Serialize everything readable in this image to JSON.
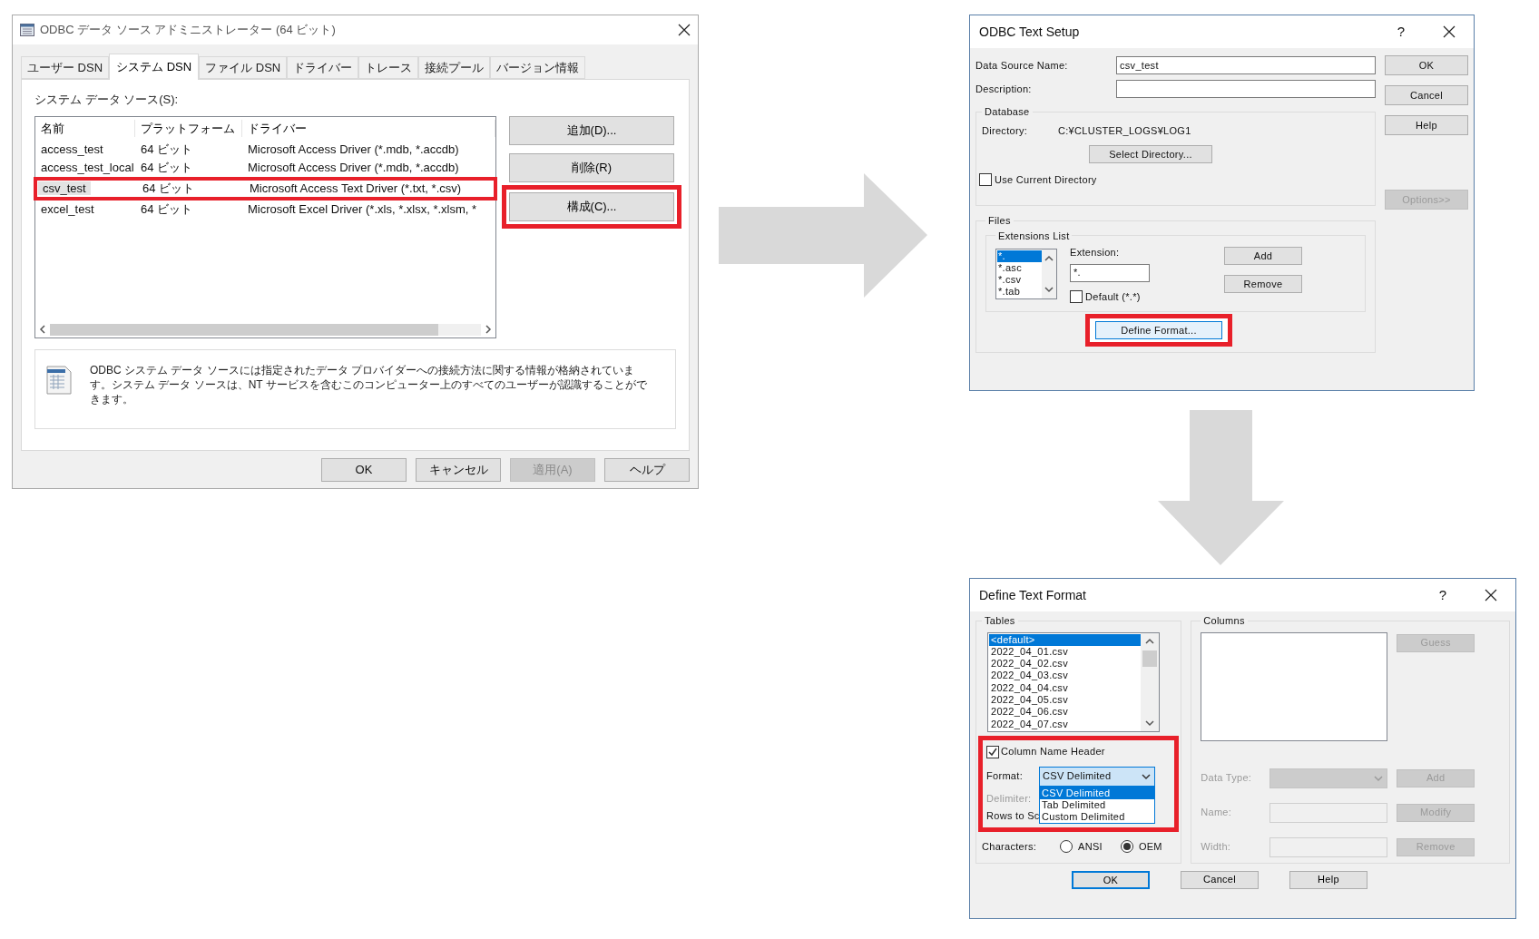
{
  "admin_window": {
    "title": "ODBC データ ソース アドミニストレーター (64 ビット)",
    "tabs": [
      {
        "label": "ユーザー DSN",
        "selected": false
      },
      {
        "label": "システム DSN",
        "selected": true
      },
      {
        "label": "ファイル DSN",
        "selected": false
      },
      {
        "label": "ドライバー",
        "selected": false
      },
      {
        "label": "トレース",
        "selected": false
      },
      {
        "label": "接続プール",
        "selected": false
      },
      {
        "label": "バージョン情報",
        "selected": false
      }
    ],
    "list_label": "システム データ ソース(S):",
    "columns": [
      "名前",
      "プラットフォーム",
      "ドライバー"
    ],
    "rows": [
      {
        "name": "access_test",
        "platform": "64 ビット",
        "driver": "Microsoft Access Driver (*.mdb, *.accdb)",
        "selected": false,
        "highlighted": false
      },
      {
        "name": "access_test_local",
        "platform": "64 ビット",
        "driver": "Microsoft Access Driver (*.mdb, *.accdb)",
        "selected": false,
        "highlighted": false
      },
      {
        "name": "csv_test",
        "platform": "64 ビット",
        "driver": "Microsoft Access Text Driver (*.txt, *.csv)",
        "selected": true,
        "highlighted": true
      },
      {
        "name": "excel_test",
        "platform": "64 ビット",
        "driver": "Microsoft Excel Driver (*.xls, *.xlsx, *.xlsm, *",
        "selected": false,
        "highlighted": false
      }
    ],
    "side_buttons": [
      {
        "label": "追加(D)...",
        "highlighted": false
      },
      {
        "label": "削除(R)",
        "highlighted": false
      },
      {
        "label": "構成(C)...",
        "highlighted": true
      }
    ],
    "info_text": "ODBC システム データ ソースには指定されたデータ プロバイダーへの接続方法に関する情報が格納されています。システム データ ソースは、NT サービスを含むこのコンピューター上のすべてのユーザーが認識することができます。",
    "footer_buttons": [
      {
        "label": "OK",
        "disabled": false
      },
      {
        "label": "キャンセル",
        "disabled": false
      },
      {
        "label": "適用(A)",
        "disabled": true
      },
      {
        "label": "ヘルプ",
        "disabled": false
      }
    ]
  },
  "text_setup": {
    "title": "ODBC Text Setup",
    "help_mark": "?",
    "fields": [
      {
        "label": "Data Source Name:",
        "value": "csv_test"
      },
      {
        "label": "Description:"
      }
    ],
    "database": {
      "legend": "Database",
      "directory_label": "Directory:",
      "directory": "C:¥CLUSTER_LOGS¥LOG1",
      "select_button": "Select Directory...",
      "use_current": {
        "label": "Use Current Directory",
        "checked": false
      }
    },
    "buttons": [
      {
        "label": "OK",
        "disabled": false
      },
      {
        "label": "Cancel",
        "disabled": false
      },
      {
        "label": "Help",
        "disabled": false
      },
      {
        "label": "Options>>",
        "disabled": true
      }
    ],
    "files": {
      "legend": "Files",
      "extensions_legend": "Extensions List",
      "extensions": [
        {
          "label": "*.",
          "selected": true
        },
        {
          "label": "*.asc",
          "selected": false
        },
        {
          "label": "*.csv",
          "selected": false
        },
        {
          "label": "*.tab",
          "selected": false
        }
      ],
      "extension_label": "Extension:",
      "extension_value": "*.",
      "default_checkbox": {
        "label": "Default (*.*)",
        "checked": false
      },
      "add_button": "Add",
      "remove_button": "Remove",
      "define_button": {
        "label": "Define Format...",
        "highlighted": true
      }
    }
  },
  "define_format": {
    "title": "Define Text Format",
    "help_mark": "?",
    "tables": {
      "legend": "Tables",
      "items": [
        {
          "label": "<default>",
          "selected": true
        },
        {
          "label": "2022_04_01.csv",
          "selected": false
        },
        {
          "label": "2022_04_02.csv",
          "selected": false
        },
        {
          "label": "2022_04_03.csv",
          "selected": false
        },
        {
          "label": "2022_04_04.csv",
          "selected": false
        },
        {
          "label": "2022_04_05.csv",
          "selected": false
        },
        {
          "label": "2022_04_06.csv",
          "selected": false
        },
        {
          "label": "2022_04_07.csv",
          "selected": false
        }
      ]
    },
    "options": {
      "highlighted": true,
      "column_name_header": {
        "label": "Column Name Header",
        "checked": true
      },
      "format_label": "Format:",
      "format_value": "CSV Delimited",
      "format_options": [
        {
          "label": "CSV Delimited",
          "selected": true
        },
        {
          "label": "Tab Delimited",
          "selected": false
        },
        {
          "label": "Custom Delimited",
          "selected": false
        }
      ],
      "delimiter_label": "Delimiter:",
      "rows_label": "Rows to Sc"
    },
    "characters": {
      "label": "Characters:",
      "options": [
        {
          "label": "ANSI",
          "selected": false
        },
        {
          "label": "OEM",
          "selected": true
        }
      ]
    },
    "columns": {
      "legend": "Columns",
      "disabled": true,
      "guess_button": "Guess",
      "fields": [
        {
          "label": "Data Type:",
          "kind": "combo",
          "button": "Add"
        },
        {
          "label": "Name:",
          "kind": "text",
          "button": "Modify"
        },
        {
          "label": "Width:",
          "kind": "text",
          "button": "Remove"
        }
      ]
    },
    "buttons": [
      {
        "label": "OK",
        "default": true
      },
      {
        "label": "Cancel",
        "default": false
      },
      {
        "label": "Help",
        "default": false
      }
    ]
  }
}
